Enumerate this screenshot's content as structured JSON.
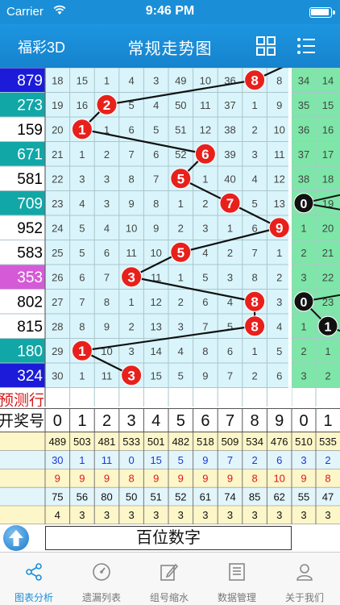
{
  "status_bar": {
    "carrier": "Carrier",
    "time": "9:46 PM"
  },
  "nav": {
    "back_label": "福彩3D",
    "title": "常规走势图",
    "grid_icon": "grid-icon",
    "list_icon": "list-icon"
  },
  "colors": {
    "accent": "#1a8fd8",
    "ball": "#e8201c",
    "black_ball": "#111111",
    "grid_bg": "#d9f5fb",
    "green_bg": "#7ee6a8",
    "stats_yellow": "#fdf6c8",
    "stats_blue": "#e2f5fb"
  },
  "left_column": {
    "rows": [
      {
        "text": "879",
        "bg": "#1b1bd9",
        "fg": "#ffffff"
      },
      {
        "text": "273",
        "bg": "#11a7a7",
        "fg": "#ffffff"
      },
      {
        "text": "159",
        "bg": "#ffffff",
        "fg": "#000000"
      },
      {
        "text": "671",
        "bg": "#11a7a7",
        "fg": "#ffffff"
      },
      {
        "text": "581",
        "bg": "#ffffff",
        "fg": "#000000"
      },
      {
        "text": "709",
        "bg": "#11a7a7",
        "fg": "#ffffff"
      },
      {
        "text": "952",
        "bg": "#ffffff",
        "fg": "#000000"
      },
      {
        "text": "583",
        "bg": "#ffffff",
        "fg": "#000000"
      },
      {
        "text": "353",
        "bg": "#d55ad8",
        "fg": "#ffffff"
      },
      {
        "text": "802",
        "bg": "#ffffff",
        "fg": "#000000"
      },
      {
        "text": "815",
        "bg": "#ffffff",
        "fg": "#000000"
      },
      {
        "text": "180",
        "bg": "#11a7a7",
        "fg": "#ffffff"
      },
      {
        "text": "324",
        "bg": "#1b1bd9",
        "fg": "#ffffff"
      }
    ],
    "predict_label": "预测行",
    "header_label": "开奖号"
  },
  "grid": {
    "rows": [
      [
        "18",
        "15",
        "1",
        "4",
        "3",
        "49",
        "10",
        "36",
        "8",
        "8"
      ],
      [
        "19",
        "16",
        "2",
        "5",
        "4",
        "50",
        "11",
        "37",
        "1",
        "9"
      ],
      [
        "20",
        "1",
        "1",
        "6",
        "5",
        "51",
        "12",
        "38",
        "2",
        "10"
      ],
      [
        "21",
        "1",
        "2",
        "7",
        "6",
        "52",
        "6",
        "39",
        "3",
        "11"
      ],
      [
        "22",
        "3",
        "3",
        "8",
        "7",
        "5",
        "1",
        "40",
        "4",
        "12"
      ],
      [
        "23",
        "4",
        "3",
        "9",
        "8",
        "1",
        "2",
        "7",
        "5",
        "13"
      ],
      [
        "24",
        "5",
        "4",
        "10",
        "9",
        "2",
        "3",
        "1",
        "6",
        "9"
      ],
      [
        "25",
        "5",
        "6",
        "11",
        "10",
        "5",
        "4",
        "2",
        "7",
        "1"
      ],
      [
        "26",
        "6",
        "7",
        "3",
        "11",
        "1",
        "5",
        "3",
        "8",
        "2"
      ],
      [
        "27",
        "7",
        "8",
        "1",
        "12",
        "2",
        "6",
        "4",
        "8",
        "3"
      ],
      [
        "28",
        "8",
        "9",
        "2",
        "13",
        "3",
        "7",
        "5",
        "8",
        "4"
      ],
      [
        "29",
        "1",
        "10",
        "3",
        "14",
        "4",
        "8",
        "6",
        "1",
        "5"
      ],
      [
        "30",
        "1",
        "11",
        "3",
        "15",
        "5",
        "9",
        "7",
        "2",
        "6"
      ]
    ],
    "balls": [
      {
        "row": 0,
        "col": 8,
        "label": "8"
      },
      {
        "row": 1,
        "col": 2,
        "label": "2"
      },
      {
        "row": 2,
        "col": 1,
        "label": "1"
      },
      {
        "row": 3,
        "col": 6,
        "label": "6"
      },
      {
        "row": 4,
        "col": 5,
        "label": "5"
      },
      {
        "row": 5,
        "col": 7,
        "label": "7"
      },
      {
        "row": 6,
        "col": 9,
        "label": "9"
      },
      {
        "row": 7,
        "col": 5,
        "label": "5"
      },
      {
        "row": 8,
        "col": 3,
        "label": "3"
      },
      {
        "row": 9,
        "col": 8,
        "label": "8"
      },
      {
        "row": 10,
        "col": 8,
        "label": "8"
      },
      {
        "row": 11,
        "col": 1,
        "label": "1"
      },
      {
        "row": 12,
        "col": 3,
        "label": "3"
      }
    ]
  },
  "right_columns": {
    "rows": [
      [
        "34",
        "14"
      ],
      [
        "35",
        "15"
      ],
      [
        "36",
        "16"
      ],
      [
        "37",
        "17"
      ],
      [
        "38",
        "18"
      ],
      [
        "0",
        "19"
      ],
      [
        "1",
        "20"
      ],
      [
        "2",
        "21"
      ],
      [
        "3",
        "22"
      ],
      [
        "0",
        "23"
      ],
      [
        "1",
        "0"
      ],
      [
        "2",
        "1"
      ],
      [
        "3",
        "2"
      ]
    ],
    "black_balls": [
      {
        "row": 5,
        "col": 0,
        "label": "0"
      },
      {
        "row": 9,
        "col": 0,
        "label": "0"
      },
      {
        "row": 10,
        "col": 1,
        "label": "1"
      }
    ]
  },
  "header_digits": [
    "0",
    "1",
    "2",
    "3",
    "4",
    "5",
    "6",
    "7",
    "8",
    "9"
  ],
  "header_right": [
    "0",
    "1"
  ],
  "stats": {
    "rows": [
      {
        "values": [
          "489",
          "503",
          "481",
          "533",
          "501",
          "482",
          "518",
          "509",
          "534",
          "476"
        ],
        "right": [
          "510",
          "535"
        ],
        "color": "#111111",
        "bg": "#fdf6c8"
      },
      {
        "values": [
          "30",
          "1",
          "11",
          "0",
          "15",
          "5",
          "9",
          "7",
          "2",
          "6"
        ],
        "right": [
          "3",
          "2"
        ],
        "color": "#1a3ad8",
        "bg": "#e2f5fb"
      },
      {
        "values": [
          "9",
          "9",
          "9",
          "8",
          "9",
          "9",
          "9",
          "9",
          "8",
          "10"
        ],
        "right": [
          "9",
          "8"
        ],
        "color": "#d81a1a",
        "bg": "#fdf6c8"
      },
      {
        "values": [
          "75",
          "56",
          "80",
          "50",
          "51",
          "52",
          "61",
          "74",
          "85",
          "62"
        ],
        "right": [
          "55",
          "47"
        ],
        "color": "#111111",
        "bg": "#e2f5fb"
      },
      {
        "values": [
          "4",
          "3",
          "3",
          "3",
          "3",
          "3",
          "3",
          "3",
          "3",
          "3"
        ],
        "right": [
          "3",
          "3"
        ],
        "color": "#111111",
        "bg": "#fdf6c8"
      }
    ]
  },
  "bottom": {
    "label": "百位数字"
  },
  "tabs": [
    {
      "label": "图表分析",
      "icon": "share-icon",
      "active": true
    },
    {
      "label": "遗漏列表",
      "icon": "gauge-icon",
      "active": false
    },
    {
      "label": "组号缩水",
      "icon": "edit-icon",
      "active": false
    },
    {
      "label": "数据管理",
      "icon": "document-icon",
      "active": false
    },
    {
      "label": "关于我们",
      "icon": "user-icon",
      "active": false
    }
  ]
}
